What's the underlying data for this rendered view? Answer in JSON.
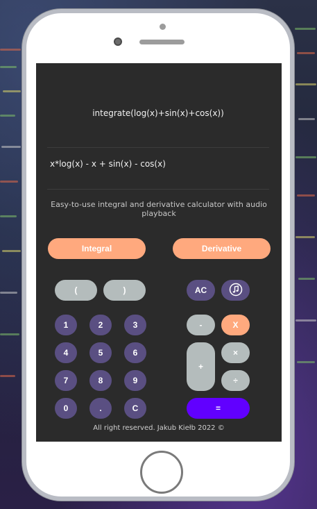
{
  "display": {
    "expression": "integrate(log(x)+sin(x)+cos(x))",
    "result": "x*log(x) - x + sin(x) - cos(x)",
    "description": "Easy-to-use integral and derivative calculator with audio playback"
  },
  "modes": {
    "integral_label": "Integral",
    "derivative_label": "Derivative"
  },
  "keys": {
    "open_paren": "(",
    "close_paren": ")",
    "ac": "AC",
    "minus": "-",
    "x": "X",
    "times": "×",
    "plus": "+",
    "divide": "÷",
    "equals": "=",
    "digits": [
      "1",
      "2",
      "3",
      "4",
      "5",
      "6",
      "7",
      "8",
      "9",
      "0"
    ],
    "dot": ".",
    "clear": "C"
  },
  "footer": "All right reserved. Jakub Kiełb 2022 ©",
  "colors": {
    "accent": "#ffa97e",
    "keypad": "#5a4f82",
    "operator": "#b4bcbc",
    "equals": "#6100ff",
    "screen": "#2b2b2b"
  },
  "icons": {
    "audio": "music-note-icon"
  }
}
